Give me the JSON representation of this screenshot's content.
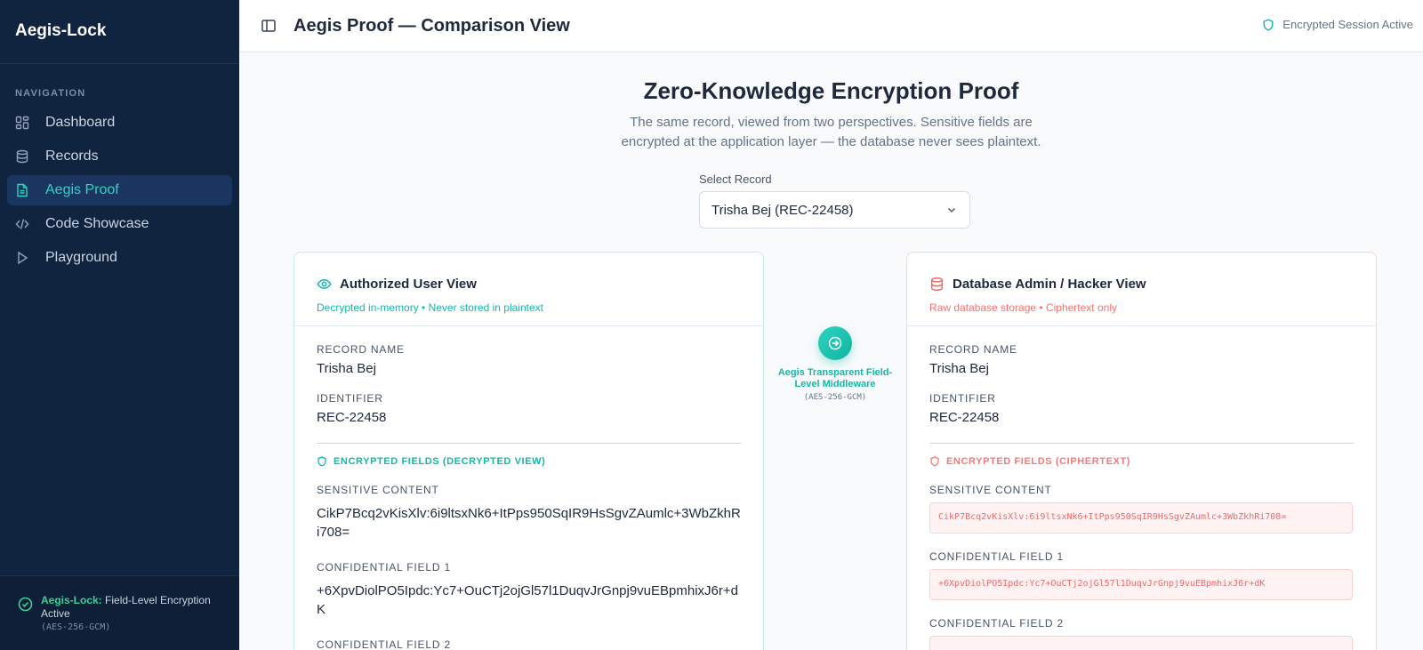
{
  "app": {
    "name": "Aegis-Lock"
  },
  "sidebar": {
    "heading": "NAVIGATION",
    "items": [
      {
        "label": "Dashboard",
        "icon": "grid-icon"
      },
      {
        "label": "Records",
        "icon": "database-icon"
      },
      {
        "label": "Aegis Proof",
        "icon": "document-icon",
        "active": true
      },
      {
        "label": "Code Showcase",
        "icon": "code-icon"
      },
      {
        "label": "Playground",
        "icon": "play-icon"
      }
    ],
    "footer": {
      "strong": "Aegis-Lock:",
      "text": " Field-Level Encryption Active",
      "mono": "(AES-256-GCM)"
    }
  },
  "header": {
    "title": "Aegis Proof — Comparison View",
    "session": "Encrypted Session Active"
  },
  "main": {
    "title": "Zero-Knowledge Encryption Proof",
    "description_line1": "The same record, viewed from two perspectives. Sensitive fields are",
    "description_line2": "encrypted at the application layer — the database never sees plaintext.",
    "select_label": "Select Record",
    "select_value": "Trisha Bej (REC-22458)"
  },
  "user_view": {
    "title": "Authorized User View",
    "subtitle": "Decrypted in-memory • Never stored in plaintext",
    "record_name_label": "RECORD NAME",
    "record_name": "Trisha Bej",
    "identifier_label": "IDENTIFIER",
    "identifier": "REC-22458",
    "encrypted_heading": "ENCRYPTED FIELDS (DECRYPTED VIEW)",
    "fields": [
      {
        "label": "SENSITIVE CONTENT",
        "value": "CikP7Bcq2vKisXlv:6i9ltsxNk6+ItPps950SqIR9HsSgvZAumlc+3WbZkhRi708="
      },
      {
        "label": "CONFIDENTIAL FIELD 1",
        "value": "+6XpvDiolPO5Ipdc:Yc7+OuCTj2ojGl57l1DuqvJrGnpj9vuEBpmhixJ6r+dK"
      },
      {
        "label": "CONFIDENTIAL FIELD 2",
        "value": ""
      }
    ]
  },
  "middleware": {
    "label": "Aegis Transparent Field-Level Middleware",
    "mono": "(AES-256-GCM)"
  },
  "db_view": {
    "title": "Database Admin / Hacker View",
    "subtitle": "Raw database storage • Ciphertext only",
    "record_name_label": "RECORD NAME",
    "record_name": "Trisha Bej",
    "identifier_label": "IDENTIFIER",
    "identifier": "REC-22458",
    "encrypted_heading": "ENCRYPTED FIELDS (CIPHERTEXT)",
    "fields": [
      {
        "label": "SENSITIVE CONTENT",
        "value": "CikP7Bcq2vKisXlv:6i9ltsxNk6+ItPps950SqIR9HsSgvZAumlc+3WbZkhRi708="
      },
      {
        "label": "CONFIDENTIAL FIELD 1",
        "value": "+6XpvDiolPO5Ipdc:Yc7+OuCTj2ojGl57l1DuqvJrGnpj9vuEBpmhixJ6r+dK"
      },
      {
        "label": "CONFIDENTIAL FIELD 2",
        "value": ""
      }
    ]
  },
  "colors": {
    "sidebar_bg": "#10233f",
    "accent_teal": "#14b8a6",
    "danger_red": "#ef6b6b"
  }
}
